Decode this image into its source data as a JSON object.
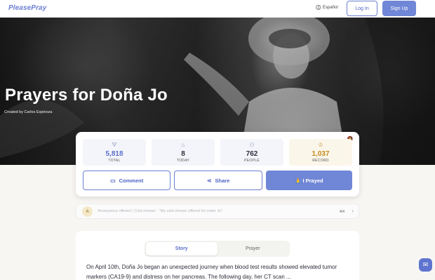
{
  "header": {
    "logo_text": "PleasePray",
    "language_label": "Español",
    "login_label": "Log In",
    "signup_label": "Sign Up"
  },
  "hero": {
    "title": "Prayers for Doña Jo",
    "creator": "Created by Carlos Espinoza"
  },
  "stats": [
    {
      "icon": "praying-hands-icon",
      "value": "5,818",
      "label": "TOTAL"
    },
    {
      "icon": "flame-icon",
      "value": "8",
      "label": "TODAY"
    },
    {
      "icon": "people-icon",
      "value": "762",
      "label": "PEOPLE"
    },
    {
      "icon": "trophy-icon",
      "value": "1,037",
      "label": "RECORD"
    }
  ],
  "actions": {
    "comment_label": "Comment",
    "share_label": "Share",
    "prayed_label": "🙏 I Prayed"
  },
  "activity": {
    "avatar_initial": "A",
    "text": "Anonymous offered 🕯 Cold shower · \"My cold shower offered for sister Jo\"",
    "count": "4/4"
  },
  "story": {
    "tabs": [
      "Story",
      "Prayer"
    ],
    "active_tab": "Story",
    "text": "On April 10th, Doña Jo began an unexpected journey when blood test results showed elevated tumor markers (CA19-9) and distress on her pancreas. The following day, her CT scan ..."
  },
  "colors": {
    "accent": "#7086d6",
    "record": "#c28a1a",
    "background": "#f7f6f3"
  }
}
